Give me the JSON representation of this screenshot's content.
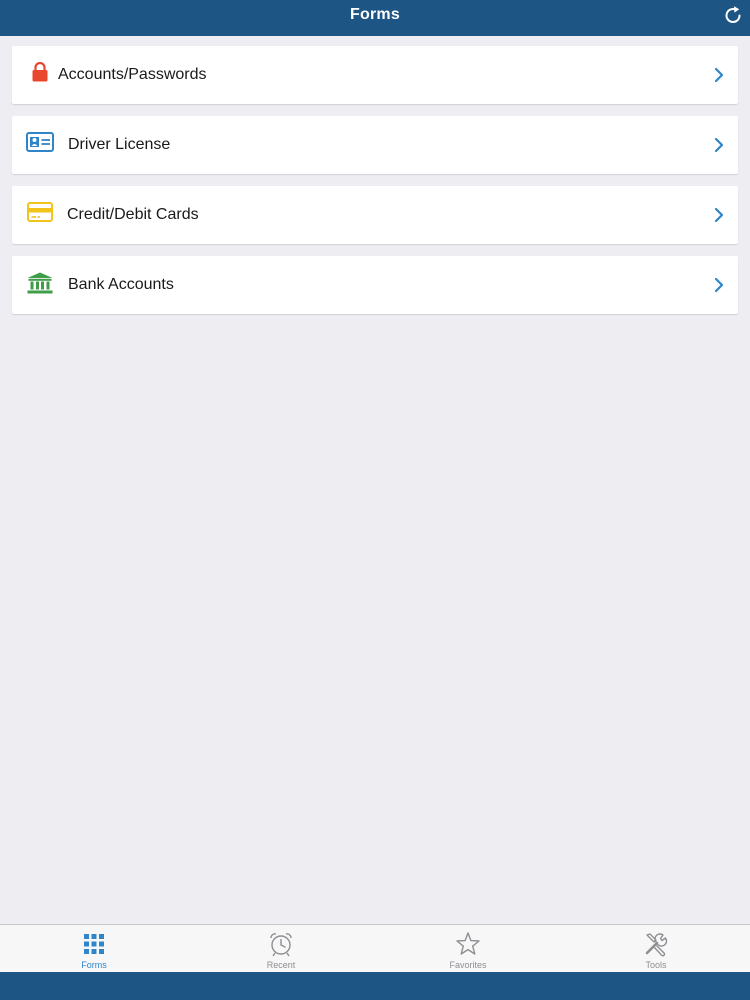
{
  "header": {
    "title": "Forms",
    "refresh_icon": "refresh-icon"
  },
  "forms": {
    "items": [
      {
        "label": "Accounts/Passwords",
        "icon": "lock-icon",
        "color": "#e8462e"
      },
      {
        "label": "Driver License",
        "icon": "id-card-icon",
        "color": "#2e86c8"
      },
      {
        "label": "Credit/Debit Cards",
        "icon": "credit-card-icon",
        "color": "#f2c318"
      },
      {
        "label": "Bank Accounts",
        "icon": "bank-icon",
        "color": "#3f9c48"
      }
    ]
  },
  "tabbar": {
    "tabs": [
      {
        "label": "Forms",
        "icon": "grid-icon",
        "active": true
      },
      {
        "label": "Recent",
        "icon": "alarm-clock-icon",
        "active": false
      },
      {
        "label": "Favorites",
        "icon": "star-icon",
        "active": false
      },
      {
        "label": "Tools",
        "icon": "tools-icon",
        "active": false
      }
    ]
  },
  "colors": {
    "header_bg": "#1d5585",
    "background": "#eeedf2",
    "accent": "#2e86c8",
    "inactive": "#8e8e93"
  }
}
